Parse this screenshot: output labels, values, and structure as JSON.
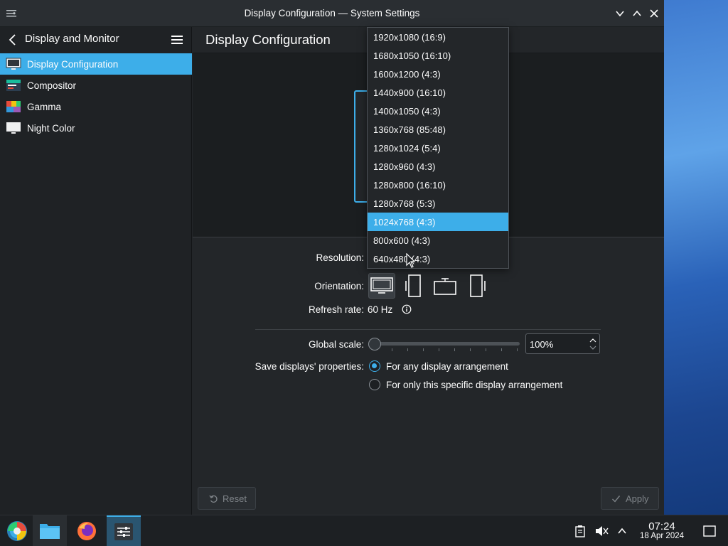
{
  "window": {
    "title": "Display Configuration — System Settings"
  },
  "sidebar": {
    "header": "Display and Monitor",
    "items": [
      {
        "label": "Display Configuration",
        "icon": "monitor-icon",
        "active": true
      },
      {
        "label": "Compositor",
        "icon": "compositor-icon",
        "active": false
      },
      {
        "label": "Gamma",
        "icon": "gamma-icon",
        "active": false
      },
      {
        "label": "Night Color",
        "icon": "night-color-icon",
        "active": false
      }
    ]
  },
  "main": {
    "title": "Display Configuration",
    "resolution_label": "Resolution:",
    "orientation_label": "Orientation:",
    "refresh_rate_label": "Refresh rate:",
    "refresh_rate_value": "60 Hz",
    "global_scale_label": "Global scale:",
    "global_scale_value": "100%",
    "save_props_label": "Save displays' properties:",
    "save_options": [
      {
        "label": "For any display arrangement",
        "selected": true
      },
      {
        "label": "For only this specific display arrangement",
        "selected": false
      }
    ],
    "reset_label": "Reset",
    "apply_label": "Apply"
  },
  "dropdown": {
    "options": [
      "1920x1080 (16:9)",
      "1680x1050 (16:10)",
      "1600x1200 (4:3)",
      "1440x900 (16:10)",
      "1400x1050 (4:3)",
      "1360x768 (85:48)",
      "1280x1024 (5:4)",
      "1280x960 (4:3)",
      "1280x800 (16:10)",
      "1280x768 (5:3)",
      "1024x768 (4:3)",
      "800x600 (4:3)",
      "640x480 (4:3)"
    ],
    "selected_index": 10
  },
  "taskbar": {
    "clock_time": "07:24",
    "clock_date": "18 Apr 2024"
  },
  "colors": {
    "accent": "#3daee9",
    "window_bg": "#232629",
    "sidebar_bg": "#1f2225"
  }
}
